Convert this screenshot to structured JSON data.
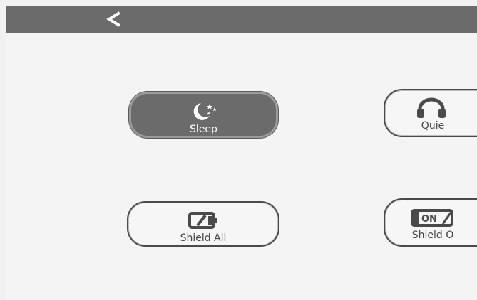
{
  "header": {
    "back_icon": "back-chevron-icon"
  },
  "modes": [
    {
      "label": "Sleep",
      "icon": "moon-stars-icon",
      "active": true
    },
    {
      "label": "Quie",
      "icon": "headphones-icon",
      "active": false
    },
    {
      "label": "Shield All",
      "icon": "battery-slash-icon",
      "active": false
    },
    {
      "label": "Shield O",
      "icon": "on-switch-icon",
      "active": false
    }
  ],
  "icon_text": {
    "on_switch": "ON"
  },
  "colors": {
    "topbar": "#6b6b6b",
    "background": "#f4f4f4",
    "active_tile": "#6b6b6b",
    "outline": "#4a4a4a"
  }
}
